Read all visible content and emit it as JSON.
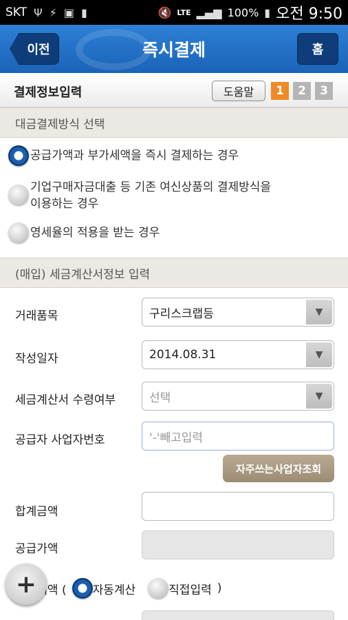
{
  "statusbar": {
    "carrier": "SKT",
    "network": "LTE",
    "battery": "100%",
    "clock": "오전 9:50"
  },
  "header": {
    "back_label": "이전",
    "title": "즉시결제",
    "home_label": "홈"
  },
  "stepbar": {
    "title": "결제정보입력",
    "help_label": "도움말",
    "steps": [
      "1",
      "2",
      "3"
    ],
    "active_step": 1
  },
  "payment_method": {
    "section_title": "대금결제방식 선택",
    "options": [
      {
        "label": "공급가액과 부가세액을 즉시 결제하는 경우",
        "selected": true
      },
      {
        "label": "기업구매자금대출 등 기존 여신상품의 결제방식을",
        "label2": "이용하는 경우",
        "selected": false
      },
      {
        "label": "영세율의 적용을 받는 경우",
        "selected": false
      }
    ]
  },
  "invoice": {
    "section_title": "(매입) 세금계산서정보 입력",
    "item_label": "거래품목",
    "item_value": "구리스크랩등",
    "date_label": "작성일자",
    "date_value": "2014.08.31",
    "receipt_label": "세금계산서 수령여부",
    "receipt_value": "선택",
    "bizno_label": "공급자 사업자번호",
    "bizno_placeholder": "'-'빼고입력",
    "search_button": "자주쓰는사업자조회",
    "total_label": "합계금액",
    "supply_label": "공급가액",
    "tax_label_prefix": "부가세액 (",
    "tax_auto": "자동계산",
    "tax_manual": "직접입력",
    "tax_label_suffix": ")"
  },
  "fab": {
    "symbol": "+"
  }
}
